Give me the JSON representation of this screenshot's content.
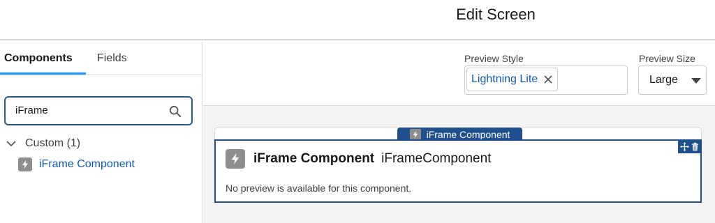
{
  "header": {
    "title": "Edit Screen"
  },
  "left_panel": {
    "tabs": [
      {
        "label": "Components",
        "active": true
      },
      {
        "label": "Fields",
        "active": false
      }
    ],
    "search": {
      "value": "iFrame",
      "placeholder": ""
    },
    "group": {
      "label": "Custom (1)",
      "expanded": true
    },
    "items": [
      {
        "label": "iFrame Component",
        "icon": "lightning-icon"
      }
    ]
  },
  "toolbar": {
    "preview_style": {
      "label": "Preview Style",
      "selected": "Lightning Lite"
    },
    "preview_size": {
      "label": "Preview Size",
      "value": "Large"
    }
  },
  "canvas": {
    "component": {
      "tab_label": "iFrame Component",
      "name": "iFrame Component",
      "api_name": "iFrameComponent",
      "note": "No preview is available for this component.",
      "actions": [
        "move-icon",
        "trash-icon"
      ]
    }
  },
  "colors": {
    "accent": "#1b96ff",
    "selection_border": "#1f4f8c",
    "link": "#0b5cab",
    "icon_gray": "#8e8e8e",
    "canvas_bg": "#f3f3f3"
  }
}
